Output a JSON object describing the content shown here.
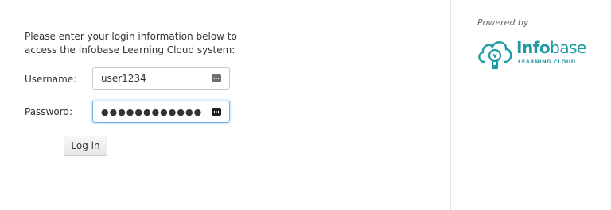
{
  "login": {
    "instructions_line1": "Please enter your login information below to",
    "instructions_line2": "access the Infobase Learning Cloud system:",
    "username_label": "Username:",
    "username_value": "user1234",
    "password_label": "Password:",
    "password_value": "●●●●●●●●●●●●",
    "login_button": "Log in"
  },
  "sidebar": {
    "powered_by": "Powered by",
    "logo_bold": "Info",
    "logo_regular": "base",
    "logo_sub": "LEARNING CLOUD",
    "brand_color": "#1f9ba3",
    "logo_icon": "cloud-lightbulb-icon"
  },
  "icons": {
    "field_key": "password-manager-key-icon"
  }
}
